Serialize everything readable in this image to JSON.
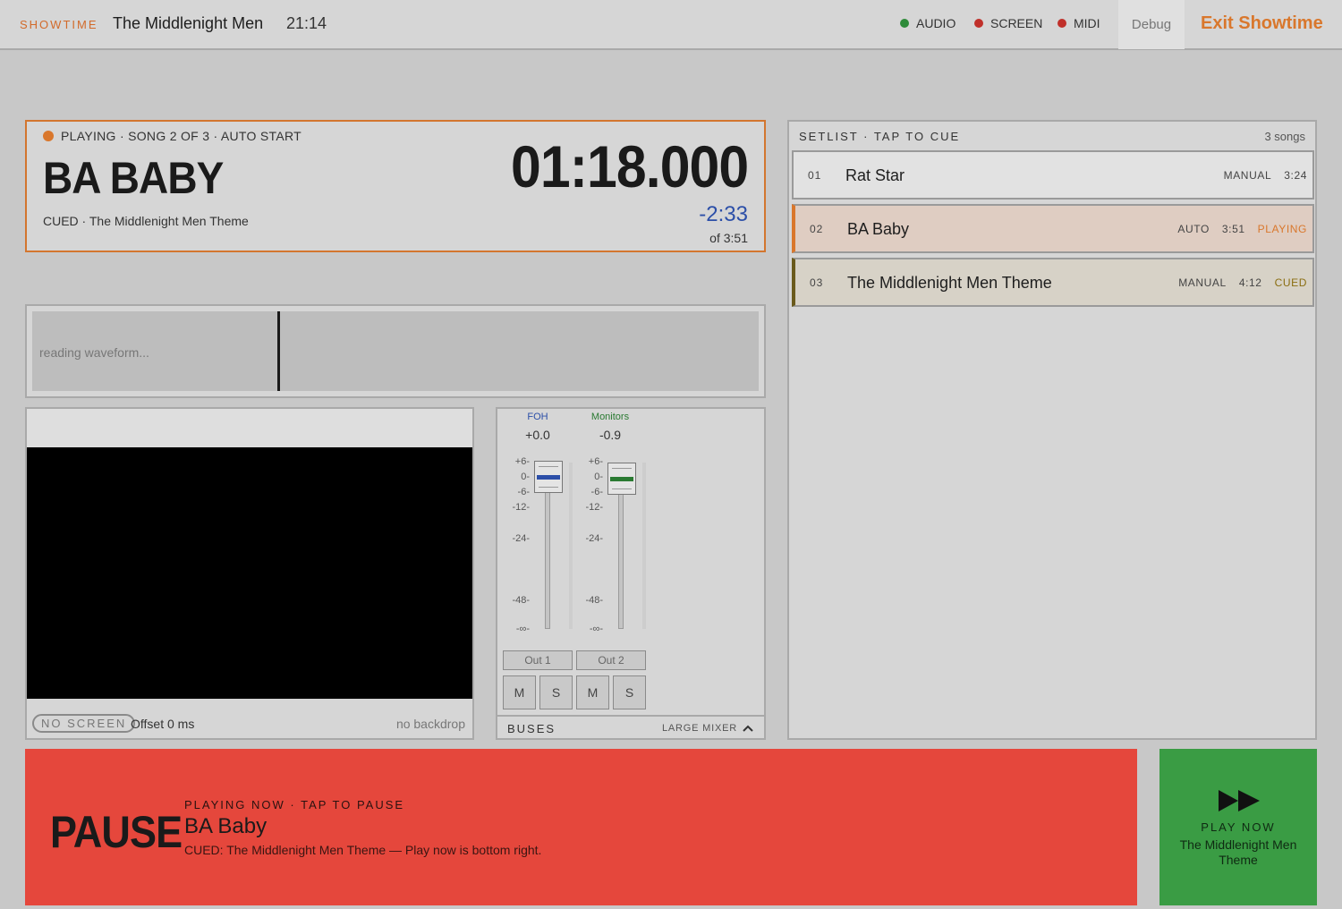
{
  "topbar": {
    "brand": "SHOWTIME",
    "band_name": "The Middlenight Men",
    "clock": "21:14",
    "statuses": [
      {
        "label": "AUDIO",
        "color": "#2e8b3a"
      },
      {
        "label": "SCREEN",
        "color": "#c0302a"
      },
      {
        "label": "MIDI",
        "color": "#c0302a"
      }
    ],
    "debug": "Debug",
    "exit": "Exit Showtime"
  },
  "now_playing": {
    "status": "PLAYING · SONG 2 OF 3 · AUTO START",
    "title": "BA BABY",
    "cued": "CUED · The Middlenight Men Theme",
    "elapsed": "01:18.000",
    "remaining": "-2:33",
    "total": "of 3:51",
    "accent": "#d9772c"
  },
  "waveform": {
    "text": "reading waveform..."
  },
  "screen": {
    "badge": "NO SCREEN",
    "offset": "Offset 0 ms",
    "backdrop": "no backdrop"
  },
  "mixer": {
    "channels": [
      {
        "name": "FOH",
        "value": "+0.0",
        "color": "#2c4fa8",
        "out": "Out 1",
        "mute": "M",
        "solo": "S"
      },
      {
        "name": "Monitors",
        "value": "-0.9",
        "color": "#2a7a32",
        "out": "Out 2",
        "mute": "M",
        "solo": "S"
      }
    ],
    "scale": [
      "+6-",
      "0-",
      "-6-",
      "-12-",
      "-24-",
      "-48-",
      "-∞-"
    ],
    "buses": "BUSES",
    "large_mixer": "LARGE MIXER"
  },
  "setlist": {
    "title": "SETLIST · TAP TO CUE",
    "count": "3 songs",
    "songs": [
      {
        "num": "01",
        "title": "Rat Star",
        "mode": "MANUAL",
        "duration": "3:24",
        "state": ""
      },
      {
        "num": "02",
        "title": "BA Baby",
        "mode": "AUTO",
        "duration": "3:51",
        "state": "PLAYING"
      },
      {
        "num": "03",
        "title": "The Middlenight Men Theme",
        "mode": "MANUAL",
        "duration": "4:12",
        "state": "CUED"
      }
    ]
  },
  "pause": {
    "big": "PAUSE",
    "label": "PLAYING NOW · TAP TO PAUSE",
    "song": "BA Baby",
    "cued": "CUED: The Middlenight Men Theme — Play now is bottom right."
  },
  "play_now": {
    "label": "PLAY NOW",
    "song": "The Middlenight Men Theme"
  }
}
